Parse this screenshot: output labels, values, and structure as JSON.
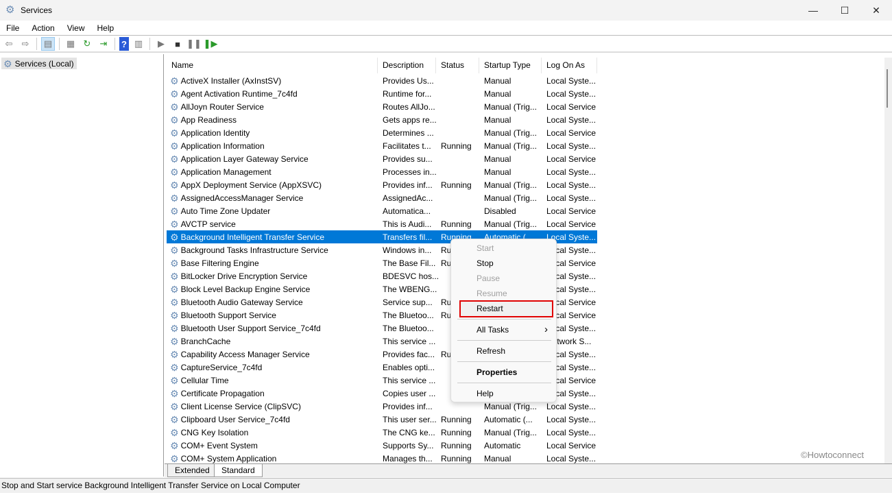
{
  "window": {
    "title": "Services",
    "icon": "gear-icon"
  },
  "menu": [
    "File",
    "Action",
    "View",
    "Help"
  ],
  "toolbar": [
    "back-icon",
    "forward-icon",
    "show-hide-console-tree-icon",
    "properties-icon",
    "refresh-icon",
    "export-list-icon",
    "help-icon",
    "show-hide-action-pane-icon",
    "start-service-icon",
    "stop-service-icon",
    "pause-service-icon",
    "restart-service-icon"
  ],
  "tree": {
    "node": "Services (Local)"
  },
  "columns": [
    "Name",
    "Description",
    "Status",
    "Startup Type",
    "Log On As"
  ],
  "rows": [
    [
      "ActiveX Installer (AxInstSV)",
      "Provides Us...",
      "",
      "Manual",
      "Local Syste..."
    ],
    [
      "Agent Activation Runtime_7c4fd",
      "Runtime for...",
      "",
      "Manual",
      "Local Syste..."
    ],
    [
      "AllJoyn Router Service",
      "Routes AllJo...",
      "",
      "Manual (Trig...",
      "Local Service"
    ],
    [
      "App Readiness",
      "Gets apps re...",
      "",
      "Manual",
      "Local Syste..."
    ],
    [
      "Application Identity",
      "Determines ...",
      "",
      "Manual (Trig...",
      "Local Service"
    ],
    [
      "Application Information",
      "Facilitates t...",
      "Running",
      "Manual (Trig...",
      "Local Syste..."
    ],
    [
      "Application Layer Gateway Service",
      "Provides su...",
      "",
      "Manual",
      "Local Service"
    ],
    [
      "Application Management",
      "Processes in...",
      "",
      "Manual",
      "Local Syste..."
    ],
    [
      "AppX Deployment Service (AppXSVC)",
      "Provides inf...",
      "Running",
      "Manual (Trig...",
      "Local Syste..."
    ],
    [
      "AssignedAccessManager Service",
      "AssignedAc...",
      "",
      "Manual (Trig...",
      "Local Syste..."
    ],
    [
      "Auto Time Zone Updater",
      "Automatica...",
      "",
      "Disabled",
      "Local Service"
    ],
    [
      "AVCTP service",
      "This is Audi...",
      "Running",
      "Manual (Trig...",
      "Local Service"
    ],
    [
      "Background Intelligent Transfer Service",
      "Transfers fil...",
      "Running",
      "Automatic (...",
      "Local Syste..."
    ],
    [
      "Background Tasks Infrastructure Service",
      "Windows in...",
      "Running",
      "",
      "Local Syste..."
    ],
    [
      "Base Filtering Engine",
      "The Base Fil...",
      "Running",
      "",
      "Local Service"
    ],
    [
      "BitLocker Drive Encryption Service",
      "BDESVC hos...",
      "",
      "",
      "Local Syste..."
    ],
    [
      "Block Level Backup Engine Service",
      "The WBENG...",
      "",
      "",
      "Local Syste..."
    ],
    [
      "Bluetooth Audio Gateway Service",
      "Service sup...",
      "Running",
      "",
      "Local Service"
    ],
    [
      "Bluetooth Support Service",
      "The Bluetoo...",
      "Running",
      "",
      "Local Service"
    ],
    [
      "Bluetooth User Support Service_7c4fd",
      "The Bluetoo...",
      "",
      "",
      "Local Syste..."
    ],
    [
      "BranchCache",
      "This service ...",
      "",
      "",
      "Network S..."
    ],
    [
      "Capability Access Manager Service",
      "Provides fac...",
      "Running",
      "",
      "Local Syste..."
    ],
    [
      "CaptureService_7c4fd",
      "Enables opti...",
      "",
      "",
      "Local Syste..."
    ],
    [
      "Cellular Time",
      "This service ...",
      "",
      "",
      "Local Service"
    ],
    [
      "Certificate Propagation",
      "Copies user ...",
      "",
      "",
      "Local Syste..."
    ],
    [
      "Client License Service (ClipSVC)",
      "Provides inf...",
      "",
      "Manual (Trig...",
      "Local Syste..."
    ],
    [
      "Clipboard User Service_7c4fd",
      "This user ser...",
      "Running",
      "Automatic (...",
      "Local Syste..."
    ],
    [
      "CNG Key Isolation",
      "The CNG ke...",
      "Running",
      "Manual (Trig...",
      "Local Syste..."
    ],
    [
      "COM+ Event System",
      "Supports Sy...",
      "Running",
      "Automatic",
      "Local Service"
    ],
    [
      "COM+ System Application",
      "Manages th...",
      "Running",
      "Manual",
      "Local Syste..."
    ]
  ],
  "selected_row": 12,
  "context_menu": [
    {
      "label": "Start",
      "disabled": true
    },
    {
      "label": "Stop"
    },
    {
      "label": "Pause",
      "disabled": true
    },
    {
      "label": "Resume",
      "disabled": true
    },
    {
      "label": "Restart",
      "highlighted": true
    },
    {
      "label": "All Tasks",
      "submenu": true
    },
    {
      "label": "Refresh"
    },
    {
      "label": "Properties",
      "bold": true
    },
    {
      "label": "Help"
    }
  ],
  "tabs": [
    "Extended",
    "Standard"
  ],
  "active_tab": "Standard",
  "status_text": "Stop and Start service Background Intelligent Transfer Service on Local Computer",
  "watermark": "©Howtoconnect",
  "colors": {
    "selection": "#0078d7",
    "highlight_box": "#e00000"
  }
}
